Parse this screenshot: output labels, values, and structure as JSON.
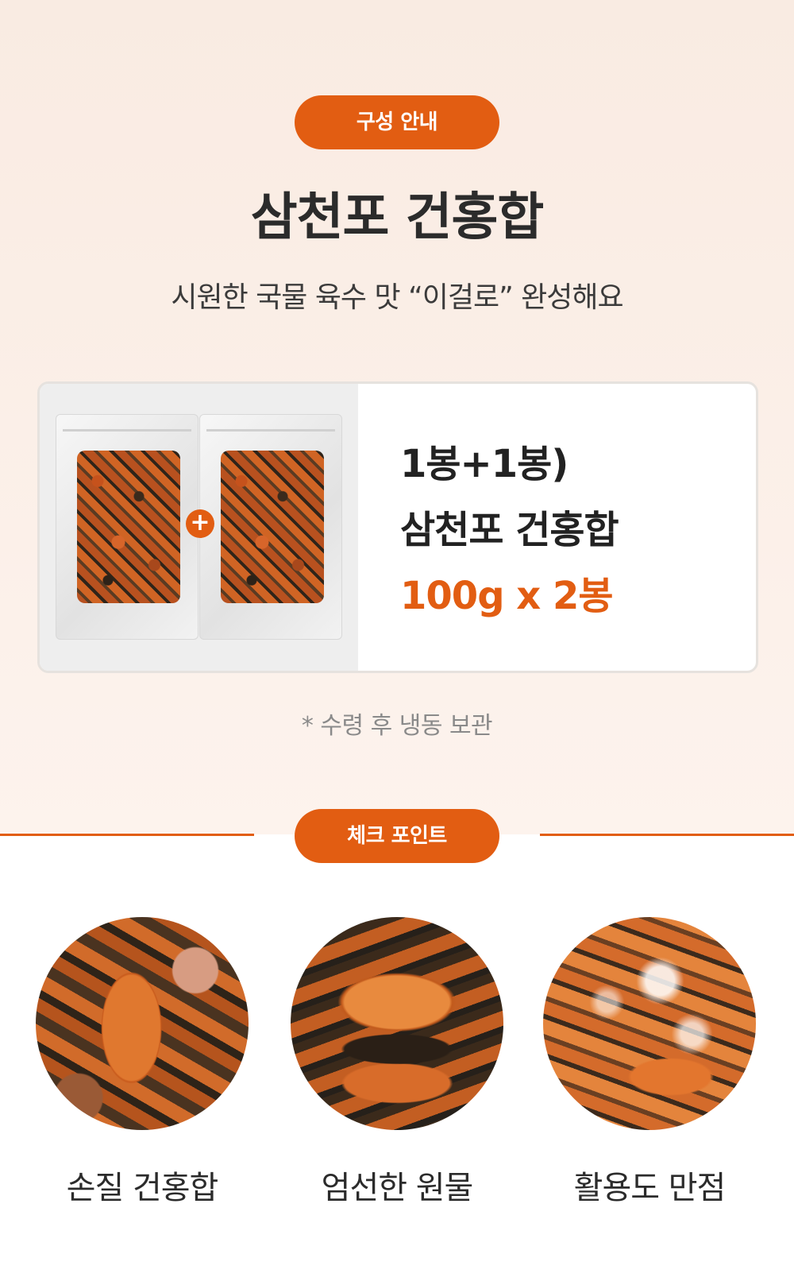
{
  "section1": {
    "badge": "구성 안내",
    "title": "삼천포 건홍합",
    "subtitle_plain": "시원한 국물 육수 맛 ",
    "subtitle_quote": "“이걸로”",
    "subtitle_end": " 완성해요"
  },
  "product_card": {
    "plus_symbol": "+",
    "line1": "1봉+1봉)",
    "line2": "삼천포 건홍합",
    "line3": "100g x 2봉"
  },
  "note": "* 수령 후 냉동 보관",
  "section2": {
    "badge": "체크 포인트",
    "points": [
      {
        "label": "손질 건홍합"
      },
      {
        "label": "엄선한 원물"
      },
      {
        "label": "활용도 만점"
      }
    ]
  },
  "colors": {
    "accent": "#e25d12",
    "background_top": "#f9ebe2",
    "text_dark": "#2b2b2b"
  }
}
